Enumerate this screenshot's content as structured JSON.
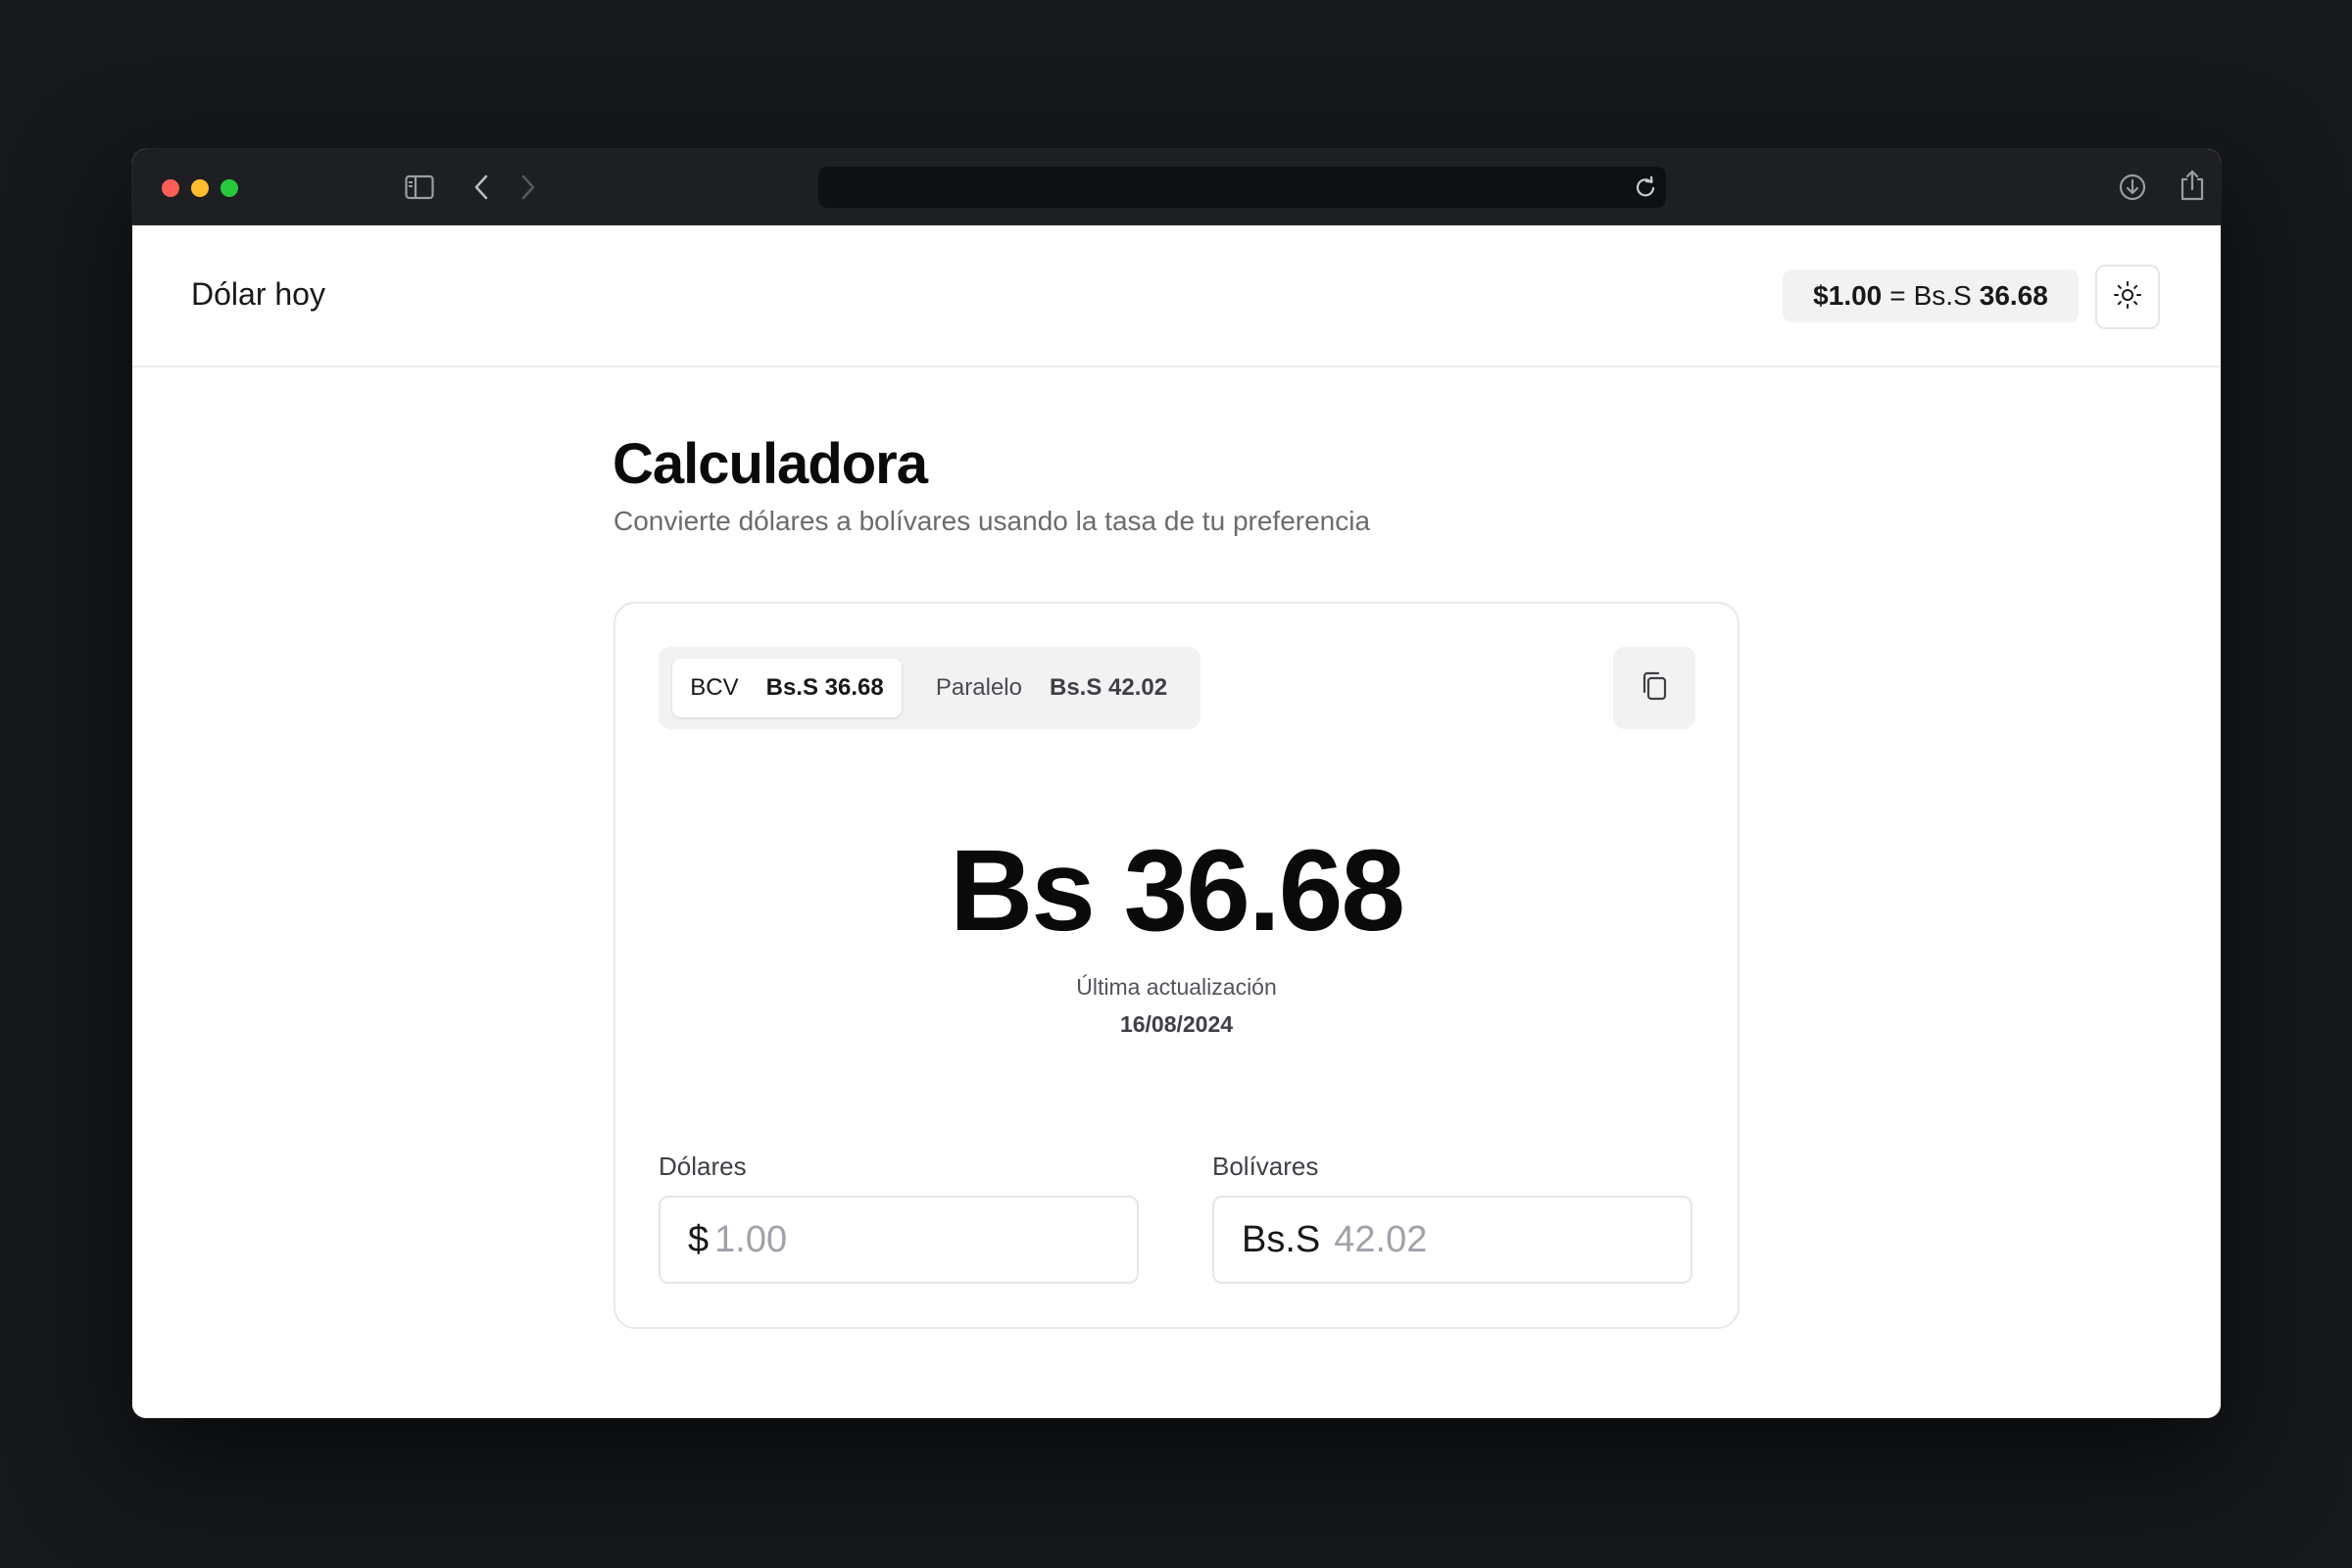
{
  "browser": {
    "url": ""
  },
  "app": {
    "brand": "Dólar hoy",
    "header_rate": {
      "usd": "$1.00",
      "equals": "=",
      "currency": "Bs.S",
      "value": "36.68"
    }
  },
  "page": {
    "title": "Calculadora",
    "subtitle": "Convierte dólares a bolívares usando la tasa de tu preferencia"
  },
  "calculator": {
    "tabs": [
      {
        "label": "BCV",
        "rate": "Bs.S 36.68",
        "active": true
      },
      {
        "label": "Paralelo",
        "rate": "Bs.S 42.02",
        "active": false
      }
    ],
    "result": "Bs 36.68",
    "update_label": "Última actualización",
    "update_date": "16/08/2024",
    "dollars": {
      "label": "Dólares",
      "prefix": "$",
      "value": "1.00"
    },
    "bolivares": {
      "label": "Bolívares",
      "prefix": "Bs.S",
      "value": "42.02"
    }
  }
}
